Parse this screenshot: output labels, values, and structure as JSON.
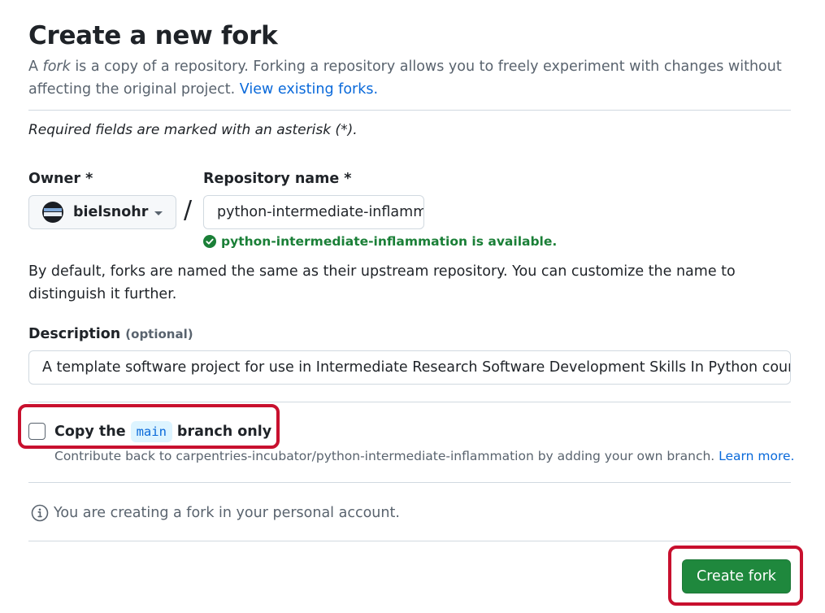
{
  "page": {
    "title": "Create a new fork",
    "intro": {
      "prefix": "A ",
      "fork_word": "fork",
      "body": " is a copy of a repository. Forking a repository allows you to freely experiment with changes without affecting the original project. ",
      "link_text": "View existing forks."
    },
    "required_note": "Required fields are marked with an asterisk (*)."
  },
  "owner": {
    "label": "Owner *",
    "value": "bielsnohr",
    "avatar_icon": "user-avatar"
  },
  "separator": "/",
  "repository": {
    "label": "Repository name *",
    "value": "python-intermediate-inflammation",
    "availability": "python-intermediate-inflammation is available.",
    "availability_icon": "check-circle-fill-icon",
    "availability_color": "#1a7f37"
  },
  "default_note": "By default, forks are named the same as their upstream repository. You can customize the name to distinguish it further.",
  "description": {
    "label": "Description",
    "optional": "(optional)",
    "value": "A template software project for use in Intermediate Research Software Development Skills In Python course"
  },
  "copy_branch": {
    "checked": false,
    "label_before": "Copy the",
    "branch": "main",
    "label_after": "branch only",
    "help": "Contribute back to carpentries-incubator/python-intermediate-inflammation by adding your own branch. ",
    "help_link": "Learn more."
  },
  "info": {
    "icon": "info-icon",
    "text": "You are creating a fork in your personal account."
  },
  "actions": {
    "create_label": "Create fork",
    "create_color": "#1f883d"
  },
  "annotation_color": "#c8102e"
}
